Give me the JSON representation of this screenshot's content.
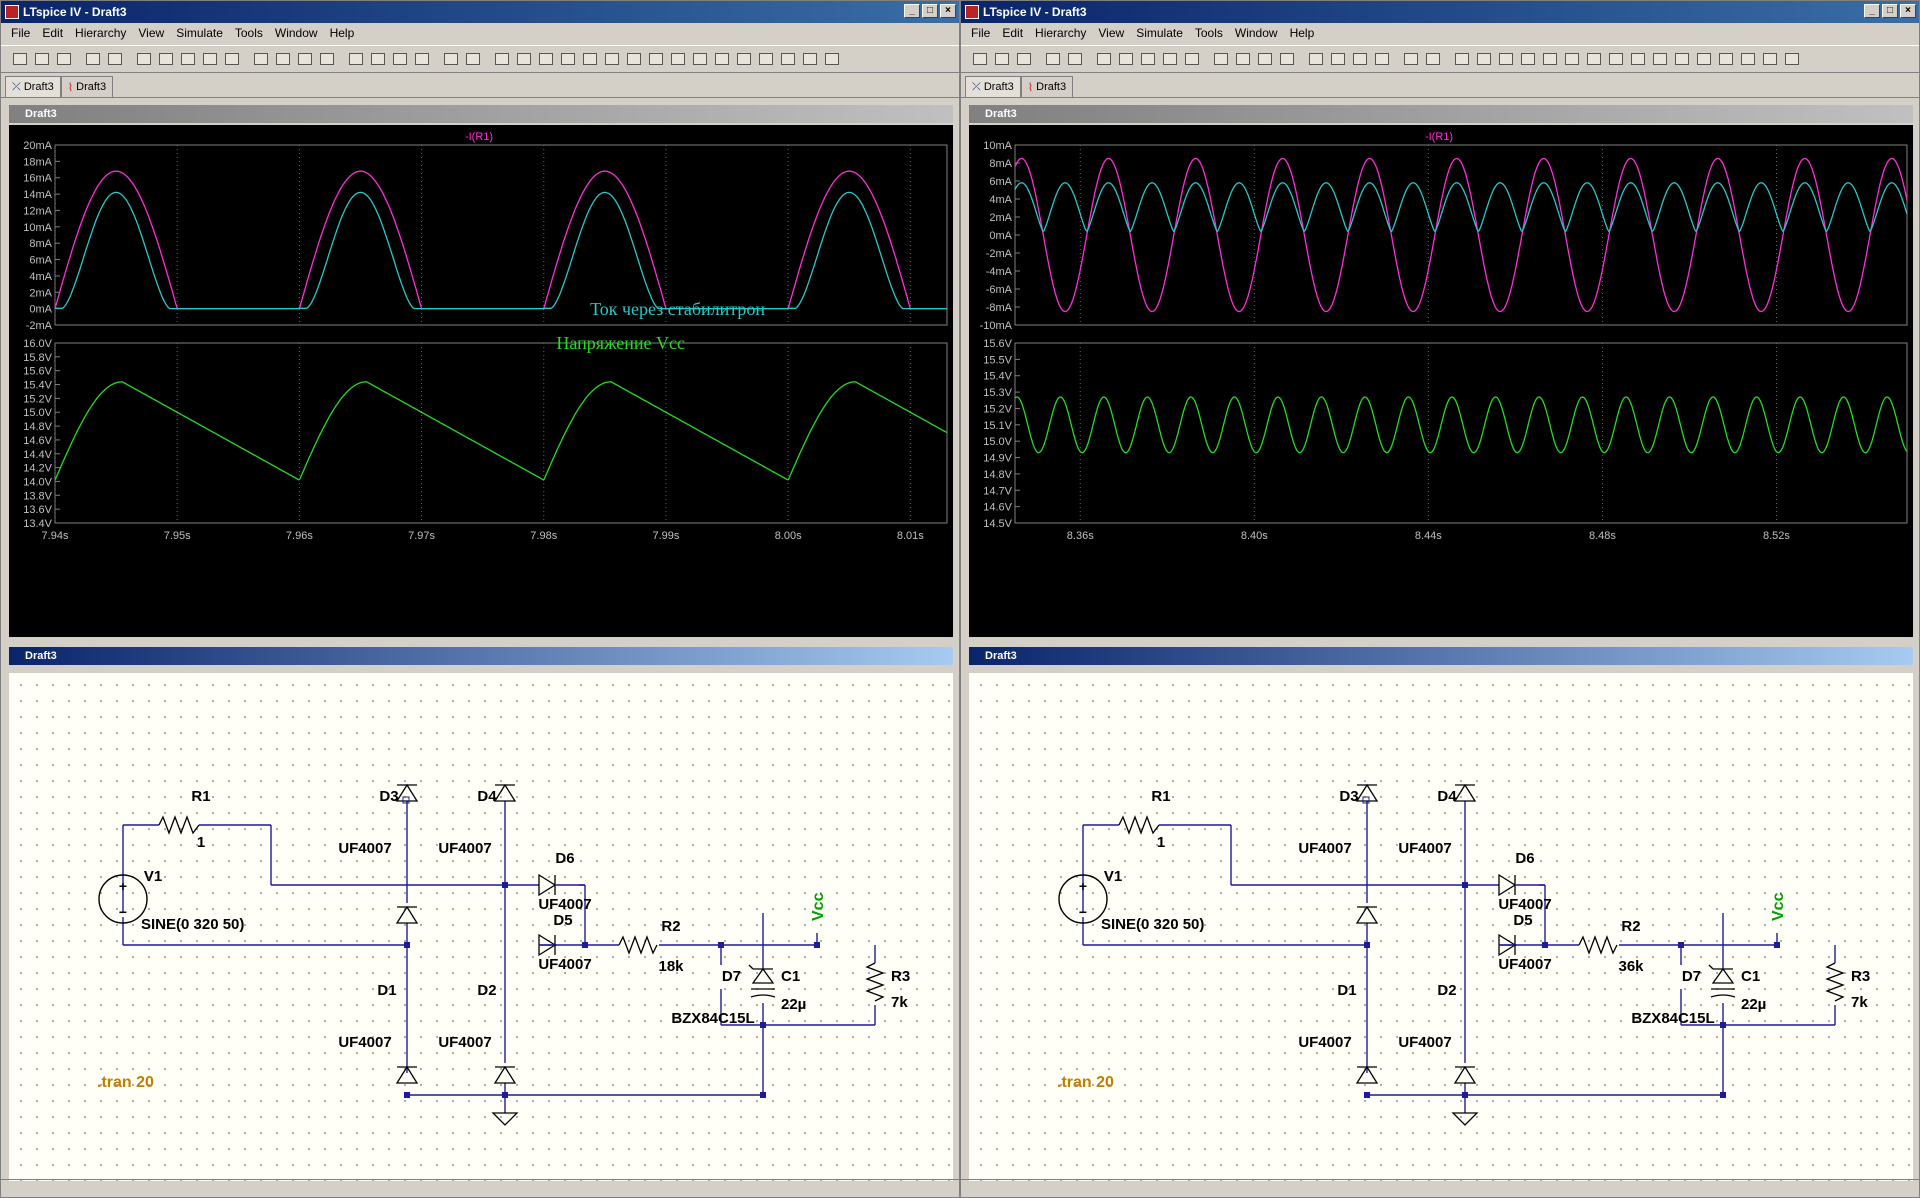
{
  "windows": [
    {
      "title": "LTspice IV - Draft3",
      "menu": [
        "File",
        "Edit",
        "Hierarchy",
        "View",
        "Simulate",
        "Tools",
        "Window",
        "Help"
      ],
      "tabs": [
        "Draft3",
        "Draft3"
      ],
      "plot_pane_title": "Draft3",
      "trace_name": "-I(R1)",
      "current_axis": [
        "20mA",
        "18mA",
        "16mA",
        "14mA",
        "12mA",
        "10mA",
        "8mA",
        "6mA",
        "4mA",
        "2mA",
        "0mA",
        "-2mA"
      ],
      "voltage_axis": [
        "16.0V",
        "15.8V",
        "15.6V",
        "15.4V",
        "15.2V",
        "15.0V",
        "14.8V",
        "14.6V",
        "14.4V",
        "14.2V",
        "14.0V",
        "13.8V",
        "13.6V",
        "13.4V"
      ],
      "time_axis": [
        "7.94s",
        "7.95s",
        "7.96s",
        "7.97s",
        "7.98s",
        "7.99s",
        "8.00s",
        "8.01s"
      ],
      "annotation_current": "Ток через стабилитрон",
      "annotation_voltage": "Напряжение Vcc",
      "schematic_title": "Draft3",
      "schematic": {
        "r1_name": "R1",
        "r1_value": "1",
        "v1_name": "V1",
        "v1_value": "SINE(0 320 50)",
        "d1": "D1",
        "d2": "D2",
        "d3": "D3",
        "d4": "D4",
        "d5": "D5",
        "d6": "D6",
        "d7": "D7",
        "diode_model": "UF4007",
        "zener_model": "BZX84C15L",
        "r2_name": "R2",
        "r2_value": "18k",
        "c1_name": "C1",
        "c1_value": "22µ",
        "r3_name": "R3",
        "r3_value": "7k",
        "vcc": "Vcc",
        "directive": ".tran 20"
      }
    },
    {
      "title": "LTspice IV - Draft3",
      "menu": [
        "File",
        "Edit",
        "Hierarchy",
        "View",
        "Simulate",
        "Tools",
        "Window",
        "Help"
      ],
      "tabs": [
        "Draft3",
        "Draft3"
      ],
      "plot_pane_title": "Draft3",
      "trace_name": "-I(R1)",
      "current_axis": [
        "10mA",
        "8mA",
        "6mA",
        "4mA",
        "2mA",
        "0mA",
        "-2mA",
        "-4mA",
        "-6mA",
        "-8mA",
        "-10mA"
      ],
      "voltage_axis": [
        "15.6V",
        "15.5V",
        "15.4V",
        "15.3V",
        "15.2V",
        "15.1V",
        "15.0V",
        "14.9V",
        "14.8V",
        "14.7V",
        "14.6V",
        "14.5V"
      ],
      "time_axis": [
        "8.36s",
        "8.40s",
        "8.44s",
        "8.48s",
        "8.52s"
      ],
      "schematic_title": "Draft3",
      "schematic": {
        "r1_name": "R1",
        "r1_value": "1",
        "v1_name": "V1",
        "v1_value": "SINE(0 320 50)",
        "d1": "D1",
        "d2": "D2",
        "d3": "D3",
        "d4": "D4",
        "d5": "D5",
        "d6": "D6",
        "d7": "D7",
        "diode_model": "UF4007",
        "zener_model": "BZX84C15L",
        "r2_name": "R2",
        "r2_value": "36k",
        "c1_name": "C1",
        "c1_value": "22µ",
        "r3_name": "R3",
        "r3_value": "7k",
        "vcc": "Vcc",
        "directive": ".tran 20"
      }
    }
  ],
  "chart_data": [
    {
      "type": "line",
      "x_range": [
        7.94,
        8.013
      ],
      "ylim": [
        -0.002,
        0.02
      ],
      "series": [
        {
          "color": "#ff2dd8",
          "peaks_x": [
            7.945,
            7.965,
            7.985,
            8.005
          ],
          "peak": 0.0168
        },
        {
          "color": "#28c8c8",
          "peaks_x": [
            7.9455,
            7.9655,
            7.9855,
            8.0055
          ],
          "peak": 0.0142,
          "label": "Ток через стабилитрон"
        }
      ]
    },
    {
      "type": "line",
      "x_range": [
        7.94,
        8.013
      ],
      "ylim": [
        13.4,
        16.0
      ],
      "series": [
        {
          "color": "#22dd22",
          "max": 15.44,
          "min": 14.02,
          "label": "Напряжение Vcc"
        }
      ]
    },
    {
      "type": "line",
      "x_range": [
        8.345,
        8.55
      ],
      "ylim": [
        -0.01,
        0.01
      ],
      "series": [
        {
          "color": "#ff2dd8",
          "amplitude": 0.0085,
          "frequency_hz": 50
        },
        {
          "color": "#28c8c8",
          "max": 0.0058,
          "min": 0.0004,
          "frequency_hz": 100
        }
      ]
    },
    {
      "type": "line",
      "x_range": [
        8.345,
        8.55
      ],
      "ylim": [
        14.5,
        15.6
      ],
      "series": [
        {
          "color": "#22dd22",
          "max": 15.27,
          "min": 14.93,
          "frequency_hz": 100
        }
      ]
    }
  ],
  "colors": {
    "wire": "#1c1c98",
    "node": "#1c1c98",
    "label": "#000000",
    "vcc": "#00a000",
    "directive": "#c08000",
    "trace_title": "#ff2dd8"
  }
}
